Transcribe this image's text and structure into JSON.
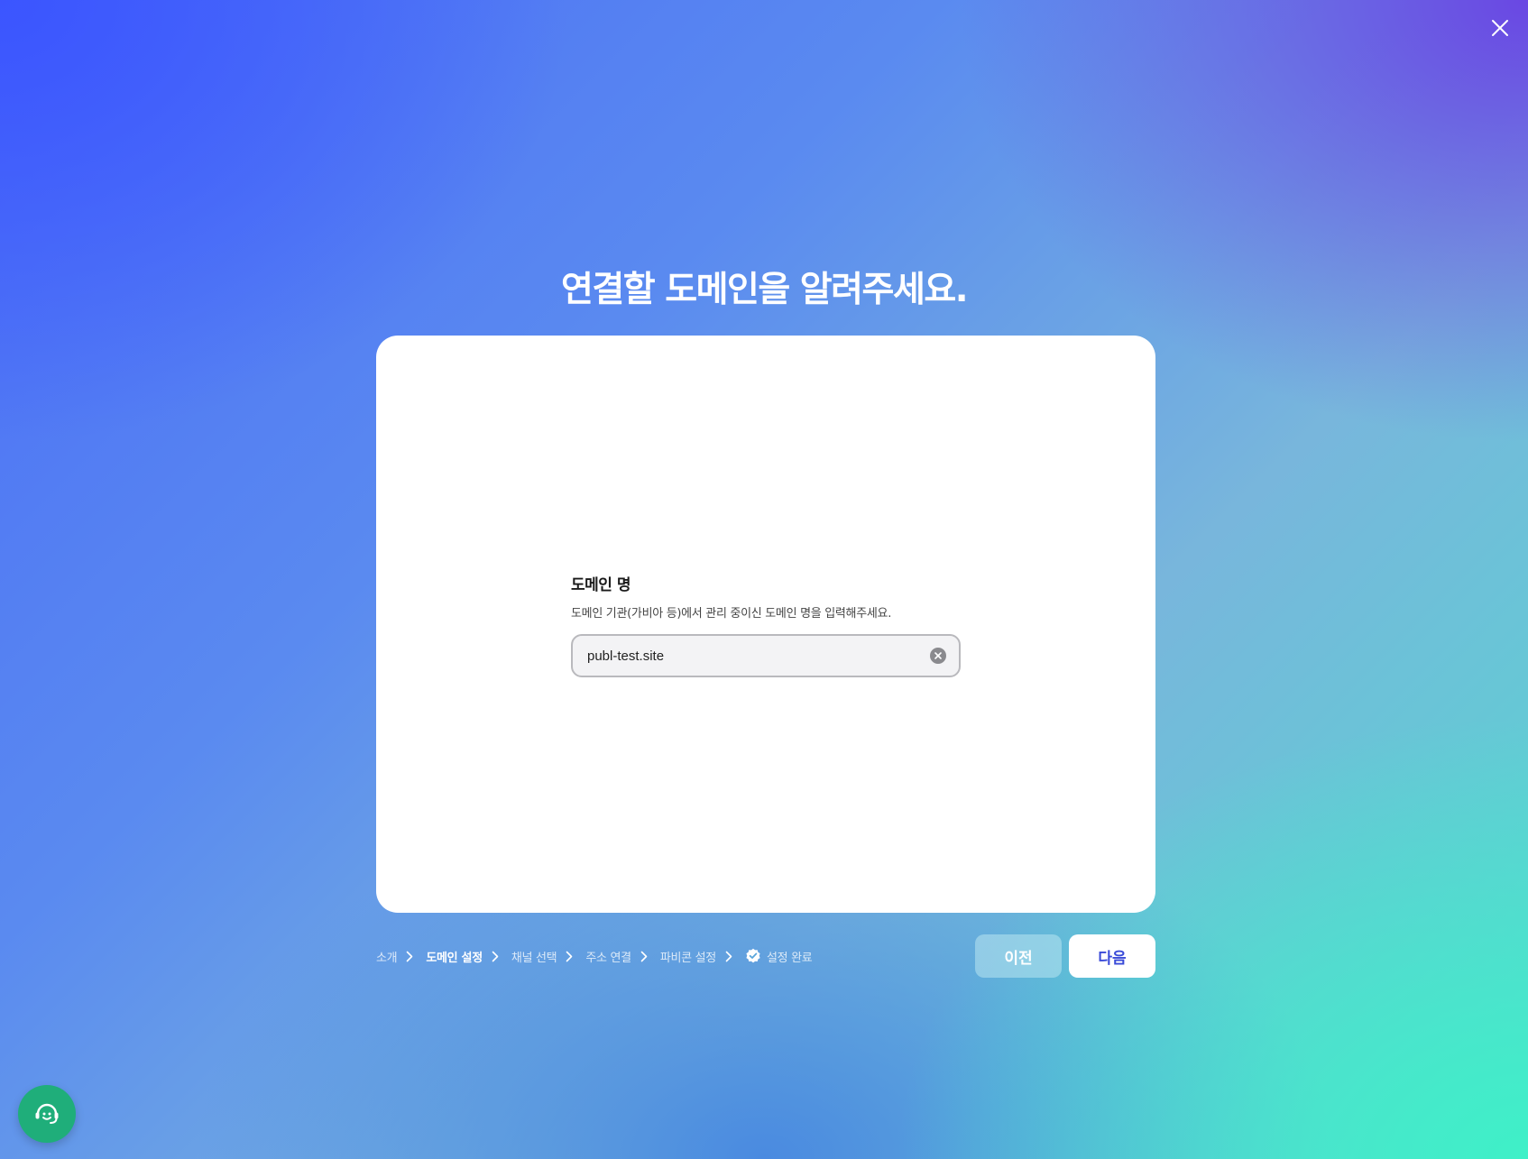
{
  "title": "연결할 도메인을 알려주세요.",
  "close_icon": "close-icon",
  "form": {
    "label": "도메인 명",
    "description": "도메인 기관(가비아 등)에서 관리 중이신 도메인 명을 입력해주세요.",
    "domain_value": "publ-test.site",
    "clear_icon": "clear-circle-icon"
  },
  "steps": [
    {
      "label": "소개",
      "active": false
    },
    {
      "label": "도메인 설정",
      "active": true
    },
    {
      "label": "채널 선택",
      "active": false
    },
    {
      "label": "주소 연결",
      "active": false
    },
    {
      "label": "파비콘 설정",
      "active": false
    },
    {
      "label": "설정 완료",
      "active": false,
      "icon": "check-badge-icon"
    }
  ],
  "buttons": {
    "prev_label": "이전",
    "next_label": "다음"
  },
  "support": {
    "icon": "headset-smile-icon"
  },
  "colors": {
    "primary_text": "#3a4bd8",
    "support_bg": "#1fae7a"
  }
}
